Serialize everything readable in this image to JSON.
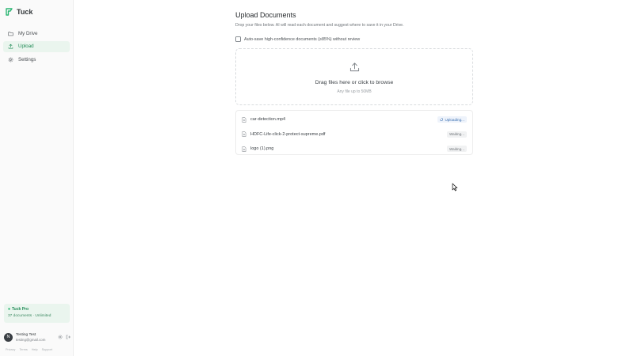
{
  "app": {
    "name": "Tuck",
    "brand_color": "#2bb673"
  },
  "sidebar": {
    "items": [
      {
        "label": "My Drive",
        "icon": "folder-icon",
        "active": false
      },
      {
        "label": "Upload",
        "icon": "upload-icon",
        "active": true
      },
      {
        "label": "Settings",
        "icon": "gear-icon",
        "active": false
      }
    ],
    "pro": {
      "title": "Tuck Pro",
      "subtitle": "37 documents · Unlimited"
    },
    "user": {
      "initial": "N",
      "name": "Testing Test",
      "email": "testing@gmail.com"
    },
    "footer_links": [
      "Privacy",
      "Terms",
      "Help",
      "Support"
    ]
  },
  "main": {
    "title": "Upload Documents",
    "subtitle": "Drop your files below. AI will read each document and suggest where to save it in your Drive.",
    "autosave_label": "Auto-save high-confidence documents (≥85%) without review",
    "autosave_checked": false,
    "dropzone": {
      "label": "Drag files here or click to browse",
      "hint": "Any file up to 50MB"
    },
    "files": [
      {
        "name": "car-detection.mp4",
        "status": "Uploading...",
        "state": "uploading"
      },
      {
        "name": "HDFC-Life-click-2-protect-supreme.pdf",
        "status": "Waiting...",
        "state": "waiting"
      },
      {
        "name": "logo (1).png",
        "status": "Waiting...",
        "state": "waiting"
      }
    ]
  }
}
